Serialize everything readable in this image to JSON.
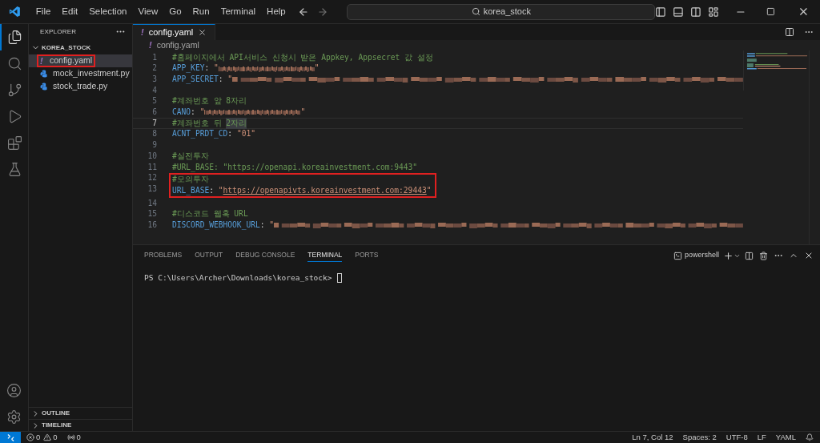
{
  "menu": [
    "File",
    "Edit",
    "Selection",
    "View",
    "Go",
    "Run",
    "Terminal",
    "Help"
  ],
  "search": {
    "value": "korea_stock"
  },
  "activity": [
    {
      "kind": "files",
      "selected": true
    },
    {
      "kind": "search",
      "selected": false
    },
    {
      "kind": "git",
      "selected": false
    },
    {
      "kind": "debug",
      "selected": false
    },
    {
      "kind": "extensions",
      "selected": false
    },
    {
      "kind": "testing",
      "selected": false
    }
  ],
  "sidebar": {
    "title": "EXPLORER",
    "folder": {
      "name": "KOREA_STOCK",
      "expanded": true,
      "files": [
        {
          "name": "config.yaml",
          "kind": "yaml",
          "icon": "!",
          "selected": true,
          "annotated": true
        },
        {
          "name": "mock_investment.py",
          "kind": "python",
          "selected": false,
          "annotated": false
        },
        {
          "name": "stock_trade.py",
          "kind": "python",
          "selected": false,
          "annotated": false
        }
      ]
    },
    "sections": [
      {
        "name": "OUTLINE",
        "expanded": false
      },
      {
        "name": "TIMELINE",
        "expanded": false
      }
    ]
  },
  "editor": {
    "tabs": [
      {
        "label": "config.yaml",
        "icon": "!",
        "selected": true
      }
    ],
    "breadcrumb": {
      "icon": "!",
      "label": "config.yaml"
    },
    "lines": [
      {
        "number": "1",
        "current": false,
        "annotated": false,
        "segments": [
          {
            "kind": "comment",
            "text": "#홈페이지에서 API서비스 신청시 받은 Appkey, Appsecret 값 설정"
          }
        ]
      },
      {
        "number": "2",
        "current": false,
        "annotated": false,
        "segments": [
          {
            "kind": "key",
            "text": "APP_KEY"
          },
          {
            "kind": "punct",
            "text": ": "
          },
          {
            "kind": "string",
            "text": "\""
          },
          {
            "kind": "redacted",
            "cut_off": false
          },
          {
            "kind": "string",
            "text": "\""
          }
        ]
      },
      {
        "number": "3",
        "current": false,
        "annotated": false,
        "segments": [
          {
            "kind": "key",
            "text": "APP_SECRET"
          },
          {
            "kind": "punct",
            "text": ": "
          },
          {
            "kind": "string",
            "text": "\""
          },
          {
            "kind": "redacted",
            "cut_off": true
          }
        ]
      },
      {
        "number": "4",
        "current": false,
        "annotated": false
      },
      {
        "number": "5",
        "current": false,
        "annotated": false,
        "segments": [
          {
            "kind": "comment",
            "text": "#계좌번호 앞 8자리"
          }
        ]
      },
      {
        "number": "6",
        "current": false,
        "annotated": false,
        "segments": [
          {
            "kind": "key",
            "text": "CANO"
          },
          {
            "kind": "punct",
            "text": ": "
          },
          {
            "kind": "string",
            "text": "\""
          },
          {
            "kind": "redacted",
            "cut_off": false
          },
          {
            "kind": "string",
            "text": "\""
          }
        ]
      },
      {
        "number": "7",
        "current": true,
        "annotated": false,
        "segments": [
          {
            "kind": "comment",
            "text": "#계좌번호 뒤 "
          },
          {
            "kind": "comment",
            "text": "2자리",
            "highlighted": true
          }
        ]
      },
      {
        "number": "8",
        "current": false,
        "annotated": false,
        "segments": [
          {
            "kind": "key",
            "text": "ACNT_PRDT_CD"
          },
          {
            "kind": "punct",
            "text": ": "
          },
          {
            "kind": "string",
            "text": "\"01\""
          }
        ]
      },
      {
        "number": "9",
        "current": false,
        "annotated": false
      },
      {
        "number": "10",
        "current": false,
        "annotated": false,
        "segments": [
          {
            "kind": "comment",
            "text": "#실전투자"
          }
        ]
      },
      {
        "number": "11",
        "current": false,
        "annotated": false,
        "segments": [
          {
            "kind": "comment",
            "text": "#URL_BASE: \"https://openapi.koreainvestment.com:9443\""
          }
        ]
      },
      {
        "number": "12",
        "current": false,
        "annotated": true,
        "segments": [
          {
            "kind": "comment",
            "text": "#모의투자"
          }
        ]
      },
      {
        "number": "13",
        "current": false,
        "annotated": true,
        "segments": [
          {
            "kind": "key",
            "text": "URL_BASE"
          },
          {
            "kind": "punct",
            "text": ": "
          },
          {
            "kind": "string",
            "text": "\""
          },
          {
            "kind": "link",
            "text": "https://openapivts.koreainvestment.com:29443"
          },
          {
            "kind": "string",
            "text": "\""
          }
        ]
      },
      {
        "number": "14",
        "current": false,
        "annotated": false
      },
      {
        "number": "15",
        "current": false,
        "annotated": false,
        "segments": [
          {
            "kind": "comment",
            "text": "#디스코드 웹훅 URL"
          }
        ]
      },
      {
        "number": "16",
        "current": false,
        "annotated": false,
        "segments": [
          {
            "kind": "key",
            "text": "DISCORD_WEBHOOK_URL"
          },
          {
            "kind": "punct",
            "text": ": "
          },
          {
            "kind": "string",
            "text": "\""
          },
          {
            "kind": "redacted",
            "cut_off": true
          }
        ]
      }
    ]
  },
  "panel": {
    "tabs": [
      {
        "label": "PROBLEMS",
        "selected": false
      },
      {
        "label": "OUTPUT",
        "selected": false
      },
      {
        "label": "DEBUG CONSOLE",
        "selected": false
      },
      {
        "label": "TERMINAL",
        "selected": true
      },
      {
        "label": "PORTS",
        "selected": false
      }
    ],
    "shell": "powershell",
    "prompt": "PS C:\\Users\\Archer\\Downloads\\korea_stock>"
  },
  "status_bar": {
    "errors": "0",
    "warnings": "0",
    "ports": "0",
    "items": [
      "Ln 7, Col 12",
      "Spaces: 2",
      "UTF-8",
      "LF",
      "YAML"
    ]
  }
}
